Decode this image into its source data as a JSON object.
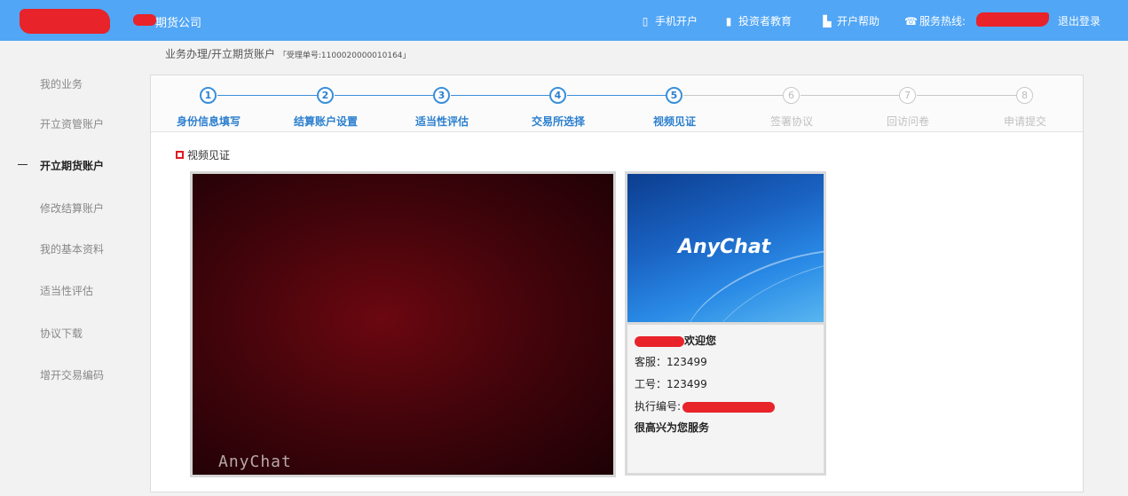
{
  "header": {
    "company": "期货公司",
    "nav": [
      {
        "icon": "mobile-icon",
        "label": "手机开户"
      },
      {
        "icon": "investor-education-icon",
        "label": "投资者教育"
      },
      {
        "icon": "help-book-icon",
        "label": "开户帮助"
      },
      {
        "icon": "phone-icon",
        "label": "服务热线:"
      }
    ],
    "logout": "退出登录"
  },
  "sidebar": {
    "items": [
      {
        "label": "我的业务"
      },
      {
        "label": "开立资管账户"
      },
      {
        "label": "开立期货账户",
        "active": true
      },
      {
        "label": "修改结算账户"
      },
      {
        "label": "我的基本资料"
      },
      {
        "label": "适当性评估"
      },
      {
        "label": "协议下载"
      },
      {
        "label": "增开交易编码"
      }
    ]
  },
  "breadcrumb": {
    "path": "业务办理/开立期货账户",
    "receipt": "「受理单号:1100020000010164」"
  },
  "steps": [
    {
      "num": "1",
      "label": "身份信息填写",
      "done": true
    },
    {
      "num": "2",
      "label": "结算账户设置",
      "done": true
    },
    {
      "num": "3",
      "label": "适当性评估",
      "done": true
    },
    {
      "num": "4",
      "label": "交易所选择",
      "done": true
    },
    {
      "num": "5",
      "label": "视频见证",
      "done": true
    },
    {
      "num": "6",
      "label": "签署协议",
      "done": false
    },
    {
      "num": "7",
      "label": "回访问卷",
      "done": false
    },
    {
      "num": "8",
      "label": "申请提交",
      "done": false
    }
  ],
  "section": {
    "title": "视频见证"
  },
  "video": {
    "main_watermark": "AnyChat",
    "side_brand": "AnyChat"
  },
  "agent_info": {
    "welcome": "欢迎您",
    "service": "客服：123499",
    "staff_no": "工号：123499",
    "exec_no_label": "执行编号:",
    "greeting": "很高兴为您服务"
  },
  "colors": {
    "topbar": "#51a6f6",
    "step_active": "#2b7fcf",
    "redaction": "#e8232a"
  }
}
